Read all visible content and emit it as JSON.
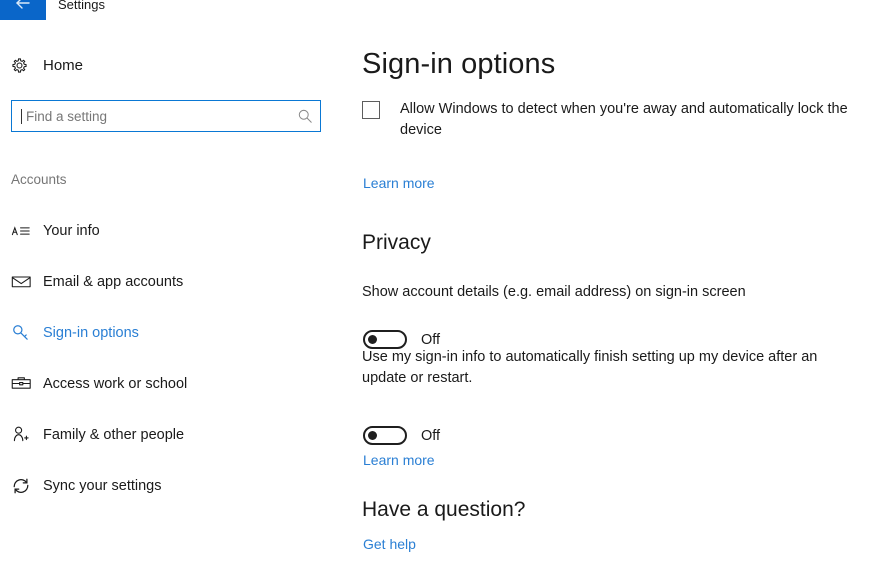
{
  "window": {
    "title": "Settings",
    "back_icon": "back-arrow-icon",
    "accent_blue": "#0a66c9",
    "link_blue": "#2a7fd4"
  },
  "sidebar": {
    "home": {
      "label": "Home",
      "icon": "gear-icon"
    },
    "search": {
      "value": "",
      "placeholder": "Find a setting",
      "icon": "search-icon"
    },
    "section_label": "Accounts",
    "items": [
      {
        "label": "Your info",
        "icon": "contact-card-icon",
        "active": false
      },
      {
        "label": "Email & app accounts",
        "icon": "envelope-icon",
        "active": false
      },
      {
        "label": "Sign-in options",
        "icon": "key-icon",
        "active": true
      },
      {
        "label": "Access work or school",
        "icon": "briefcase-icon",
        "active": false
      },
      {
        "label": "Family & other people",
        "icon": "person-add-icon",
        "active": false
      },
      {
        "label": "Sync your settings",
        "icon": "sync-icon",
        "active": false
      }
    ]
  },
  "main": {
    "page_title": "Sign-in options",
    "dynamic_lock": {
      "checkbox_label": "Allow Windows to detect when you're away and automatically lock the device",
      "checked": false,
      "learn_more": "Learn more"
    },
    "privacy": {
      "heading": "Privacy",
      "setting_one": {
        "text": "Show account details (e.g. email address) on sign-in screen",
        "toggle_state": "Off",
        "on": false
      },
      "setting_two": {
        "text": "Use my sign-in info to automatically finish setting up my device after an update or restart.",
        "toggle_state": "Off",
        "on": false
      },
      "learn_more": "Learn more"
    },
    "help": {
      "heading": "Have a question?",
      "get_help": "Get help"
    }
  }
}
